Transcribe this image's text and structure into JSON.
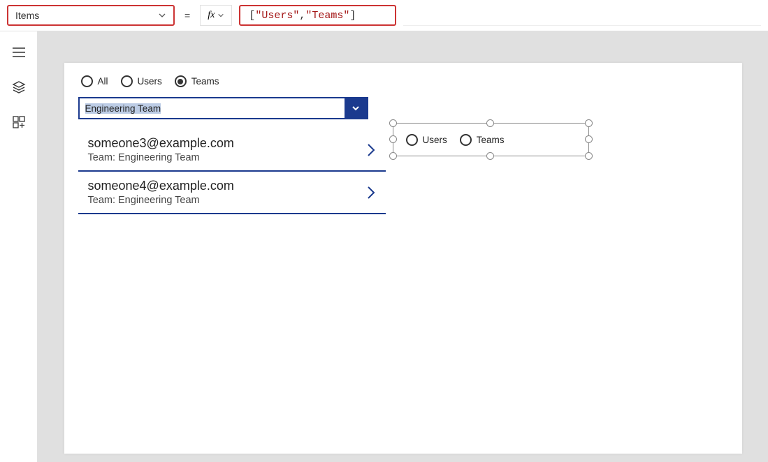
{
  "formula_bar": {
    "property": "Items",
    "fx_label": "fx",
    "formula_display": "[ \"Users\", \"Teams\" ]",
    "formula_tokens": {
      "open": "[ ",
      "s1": "\"Users\"",
      "comma": ", ",
      "s2": "\"Teams\"",
      "close": " ]"
    }
  },
  "canvas": {
    "top_radios": [
      {
        "label": "All",
        "selected": false
      },
      {
        "label": "Users",
        "selected": false
      },
      {
        "label": "Teams",
        "selected": true
      }
    ],
    "dropdown": {
      "text": "Engineering Team"
    },
    "list": [
      {
        "email": "someone3@example.com",
        "team_line": "Team: Engineering Team"
      },
      {
        "email": "someone4@example.com",
        "team_line": "Team: Engineering Team"
      }
    ],
    "selected_radio_control": [
      {
        "label": "Users",
        "selected": false
      },
      {
        "label": "Teams",
        "selected": false
      }
    ]
  }
}
